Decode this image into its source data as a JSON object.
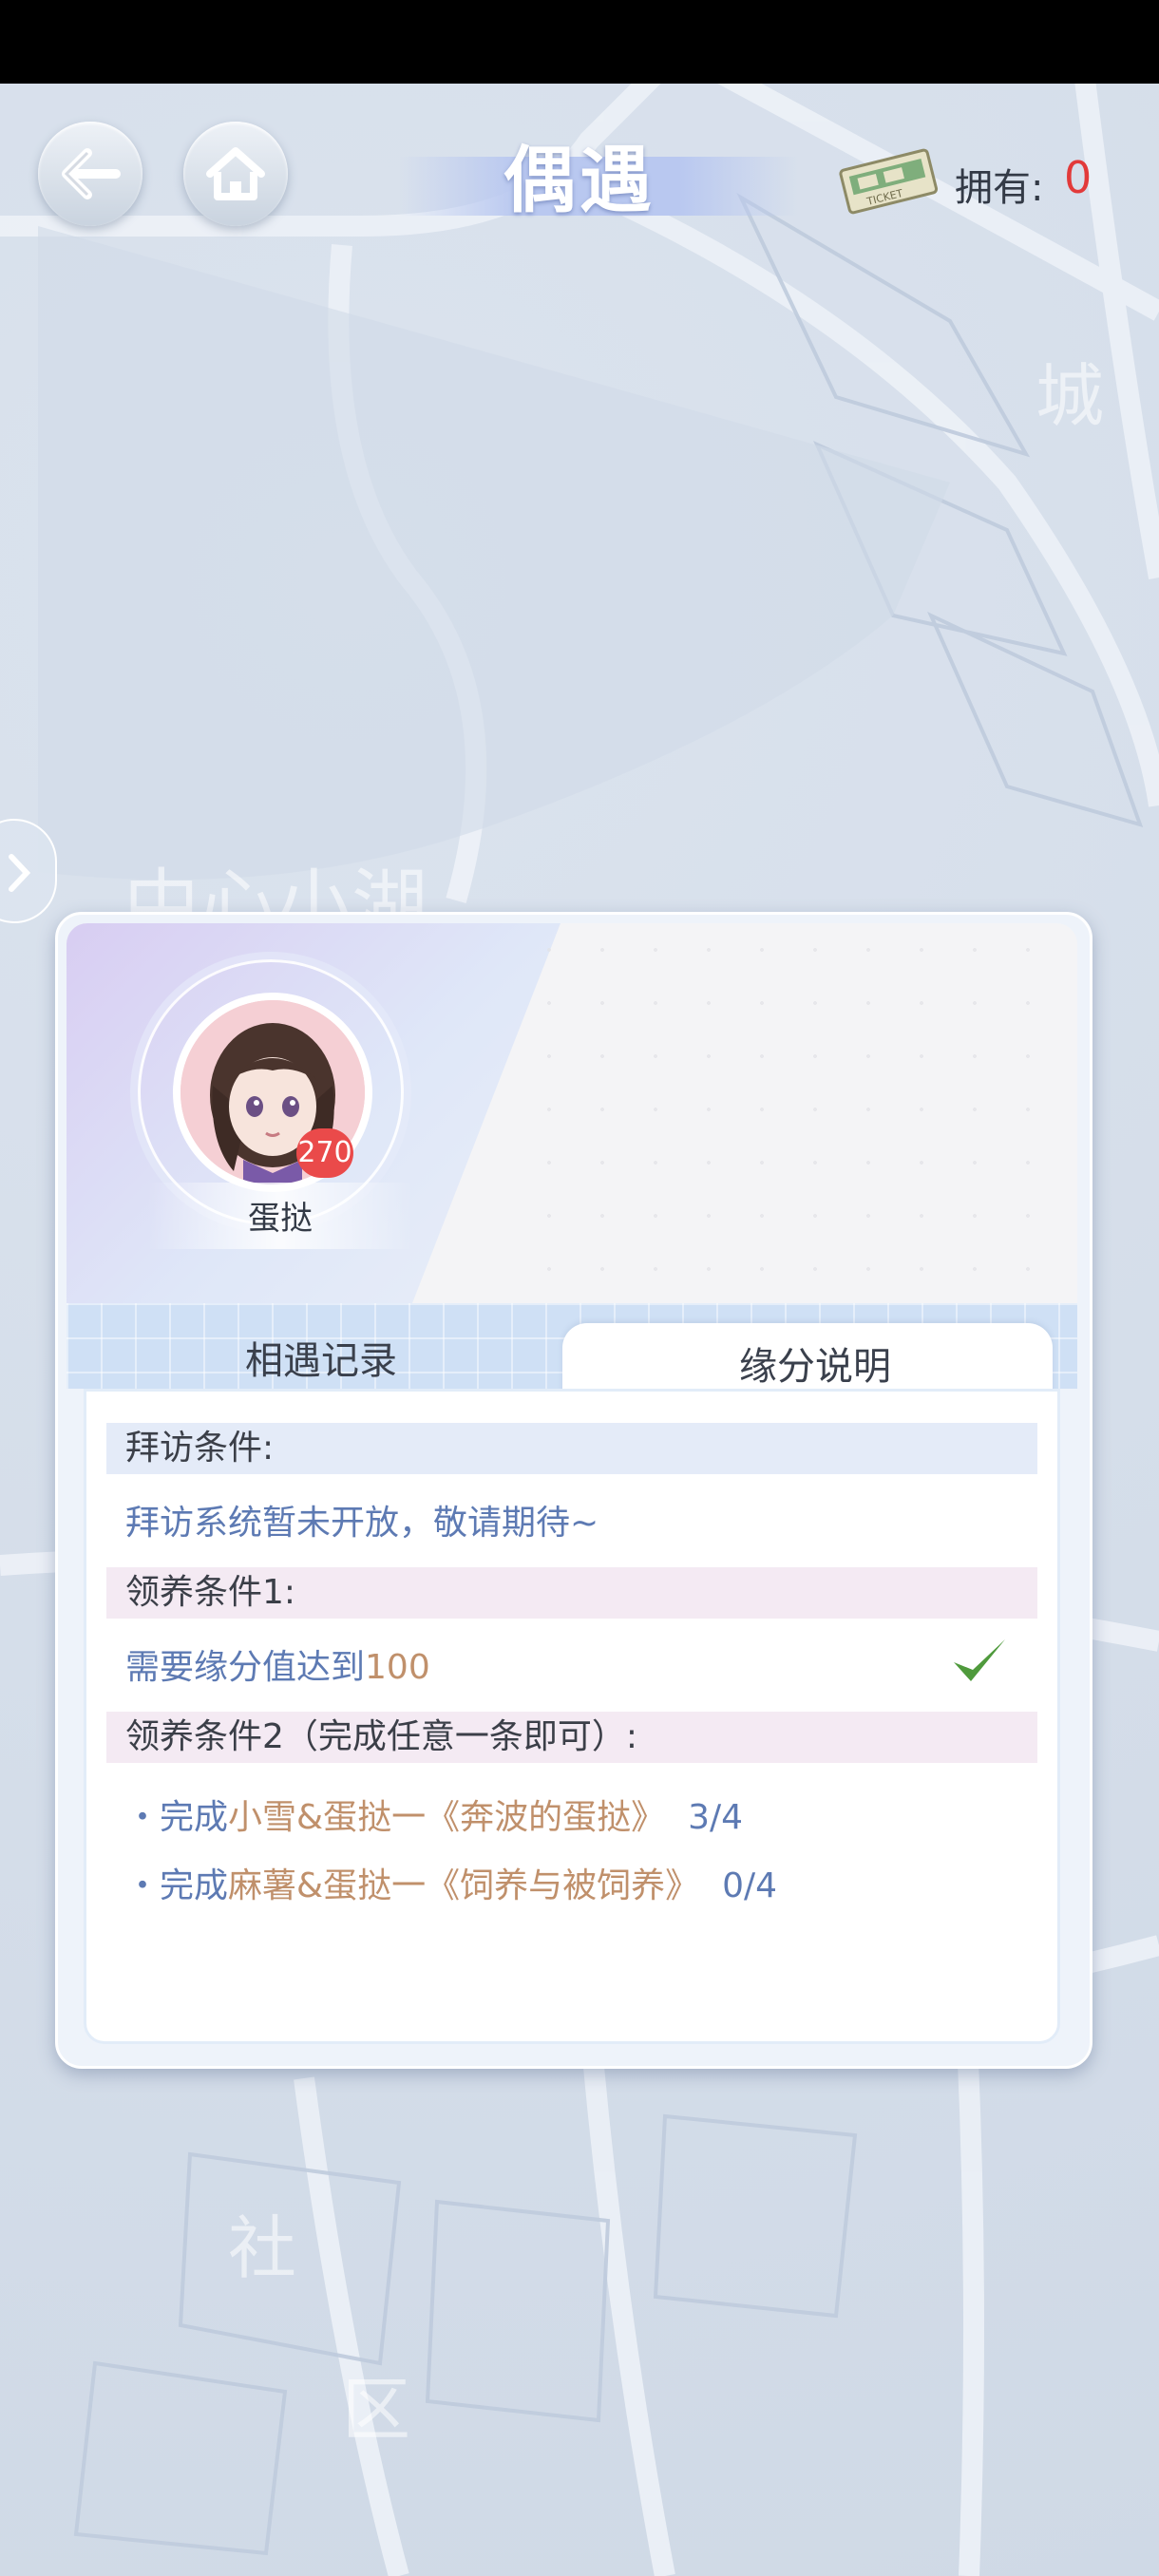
{
  "header": {
    "title": "偶遇",
    "owned_label": "拥有:",
    "owned_count": "0"
  },
  "map": {
    "labels": [
      "城",
      "中心小湖",
      "社",
      "区"
    ]
  },
  "character": {
    "name": "蛋挞",
    "level": "270"
  },
  "tabs": [
    {
      "label": "相遇记录",
      "active": false
    },
    {
      "label": "缘分说明",
      "active": true
    }
  ],
  "visit": {
    "heading": "拜访条件:",
    "text": "拜访系统暂未开放，敬请期待~"
  },
  "adopt1": {
    "heading": "领养条件1:",
    "text_prefix": "需要缘分值达到",
    "value": "100",
    "done": true
  },
  "adopt2": {
    "heading": "领养条件2（完成任意一条即可）:",
    "items": [
      {
        "bullet": "・完成",
        "name": "小雪&蛋挞一《奔波的蛋挞》",
        "progress": "3/4"
      },
      {
        "bullet": "・完成",
        "name": "麻薯&蛋挞一《饲养与被饲养》",
        "progress": "0/4"
      }
    ]
  },
  "colors": {
    "accent_blue": "#5d7ab3",
    "accent_orange": "#c0906b",
    "count_red": "#e23a3a",
    "check_green": "#4f9a3c"
  },
  "icons": [
    "back-arrow-icon",
    "home-icon",
    "ticket-icon",
    "checkmark-icon",
    "side-expand-icon"
  ]
}
